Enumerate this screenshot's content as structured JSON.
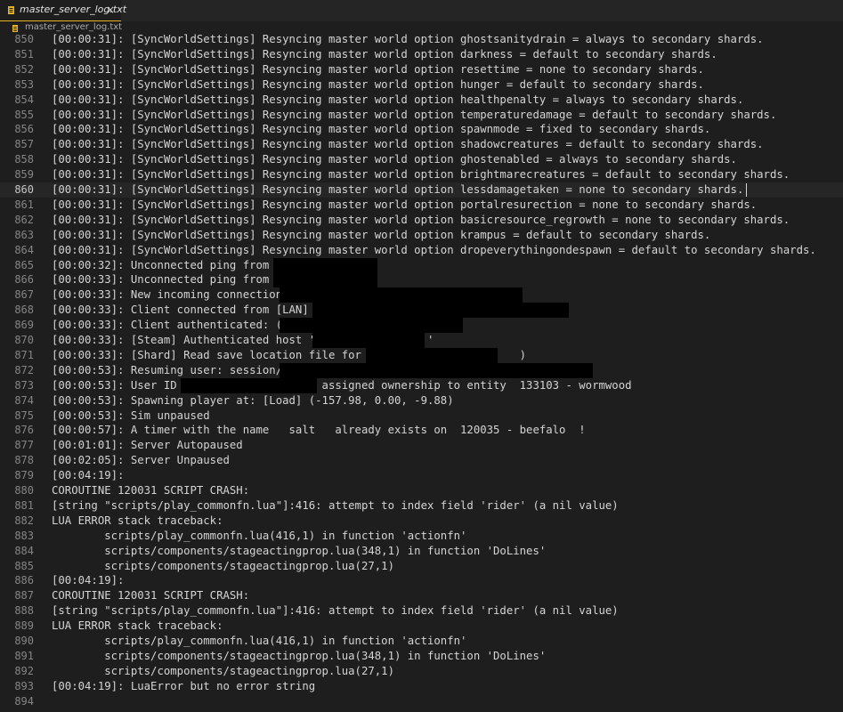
{
  "tab": {
    "label": "master_server_log.txt",
    "close_glyph": "×"
  },
  "breadcrumb": {
    "label": "master_server_log.txt"
  },
  "colors": {
    "background": "#1e1e1e",
    "tab_accent": "#e8b220",
    "text": "#d4d4d4",
    "line_number": "#858585"
  },
  "editor": {
    "current_line": "860",
    "lines": [
      {
        "n": "850",
        "text": "[00:00:31]: [SyncWorldSettings] Resyncing master world option ghostsanitydrain = always to secondary shards."
      },
      {
        "n": "851",
        "text": "[00:00:31]: [SyncWorldSettings] Resyncing master world option darkness = default to secondary shards."
      },
      {
        "n": "852",
        "text": "[00:00:31]: [SyncWorldSettings] Resyncing master world option resettime = none to secondary shards."
      },
      {
        "n": "853",
        "text": "[00:00:31]: [SyncWorldSettings] Resyncing master world option hunger = default to secondary shards."
      },
      {
        "n": "854",
        "text": "[00:00:31]: [SyncWorldSettings] Resyncing master world option healthpenalty = always to secondary shards."
      },
      {
        "n": "855",
        "text": "[00:00:31]: [SyncWorldSettings] Resyncing master world option temperaturedamage = default to secondary shards."
      },
      {
        "n": "856",
        "text": "[00:00:31]: [SyncWorldSettings] Resyncing master world option spawnmode = fixed to secondary shards."
      },
      {
        "n": "857",
        "text": "[00:00:31]: [SyncWorldSettings] Resyncing master world option shadowcreatures = default to secondary shards."
      },
      {
        "n": "858",
        "text": "[00:00:31]: [SyncWorldSettings] Resyncing master world option ghostenabled = always to secondary shards."
      },
      {
        "n": "859",
        "text": "[00:00:31]: [SyncWorldSettings] Resyncing master world option brightmarecreatures = default to secondary shards."
      },
      {
        "n": "860",
        "text": "[00:00:31]: [SyncWorldSettings] Resyncing master world option lessdamagetaken = none to secondary shards. "
      },
      {
        "n": "861",
        "text": "[00:00:31]: [SyncWorldSettings] Resyncing master world option portalresurection = none to secondary shards."
      },
      {
        "n": "862",
        "text": "[00:00:31]: [SyncWorldSettings] Resyncing master world option basicresource_regrowth = none to secondary shards."
      },
      {
        "n": "863",
        "text": "[00:00:31]: [SyncWorldSettings] Resyncing master world option krampus = default to secondary shards."
      },
      {
        "n": "864",
        "text": "[00:00:31]: [SyncWorldSettings] Resyncing master world option dropeverythingondespawn = default to secondary shards."
      },
      {
        "n": "865",
        "text": "[00:00:32]: Unconnected ping from"
      },
      {
        "n": "866",
        "text": "[00:00:33]: Unconnected ping from"
      },
      {
        "n": "867",
        "text": "[00:00:33]: New incoming connection"
      },
      {
        "n": "868",
        "text": "[00:00:33]: Client connected from [LAN]"
      },
      {
        "n": "869",
        "text": "[00:00:33]: Client authenticated: ("
      },
      {
        "n": "870",
        "text": "[00:00:33]: [Steam] Authenticated host '                 '"
      },
      {
        "n": "871",
        "text": "[00:00:33]: [Shard] Read save location file for (                      )"
      },
      {
        "n": "872",
        "text": "[00:00:53]: Resuming user: session/"
      },
      {
        "n": "873",
        "text": "[00:00:53]: User ID                      assigned ownership to entity  133103 - wormwood"
      },
      {
        "n": "874",
        "text": "[00:00:53]: Spawning player at: [Load] (-157.98, 0.00, -9.88)"
      },
      {
        "n": "875",
        "text": "[00:00:53]: Sim unpaused"
      },
      {
        "n": "876",
        "text": "[00:00:57]: A timer with the name   salt   already exists on  120035 - beefalo  !"
      },
      {
        "n": "877",
        "text": "[00:01:01]: Server Autopaused"
      },
      {
        "n": "878",
        "text": "[00:02:05]: Server Unpaused"
      },
      {
        "n": "879",
        "text": "[00:04:19]:"
      },
      {
        "n": "880",
        "text": "COROUTINE 120031 SCRIPT CRASH:"
      },
      {
        "n": "881",
        "text": "[string \"scripts/play_commonfn.lua\"]:416: attempt to index field 'rider' (a nil value)"
      },
      {
        "n": "882",
        "text": "LUA ERROR stack traceback:"
      },
      {
        "n": "883",
        "text": "        scripts/play_commonfn.lua(416,1) in function 'actionfn'"
      },
      {
        "n": "884",
        "text": "        scripts/components/stageactingprop.lua(348,1) in function 'DoLines'"
      },
      {
        "n": "885",
        "text": "        scripts/components/stageactingprop.lua(27,1)"
      },
      {
        "n": "886",
        "text": "[00:04:19]:"
      },
      {
        "n": "887",
        "text": "COROUTINE 120031 SCRIPT CRASH:"
      },
      {
        "n": "888",
        "text": "[string \"scripts/play_commonfn.lua\"]:416: attempt to index field 'rider' (a nil value)"
      },
      {
        "n": "889",
        "text": "LUA ERROR stack traceback:"
      },
      {
        "n": "890",
        "text": "        scripts/play_commonfn.lua(416,1) in function 'actionfn'"
      },
      {
        "n": "891",
        "text": "        scripts/components/stageactingprop.lua(348,1) in function 'DoLines'"
      },
      {
        "n": "892",
        "text": "        scripts/components/stageactingprop.lua(27,1)"
      },
      {
        "n": "893",
        "text": "[00:04:19]: LuaError but no error string"
      },
      {
        "n": "894",
        "text": ""
      }
    ]
  }
}
